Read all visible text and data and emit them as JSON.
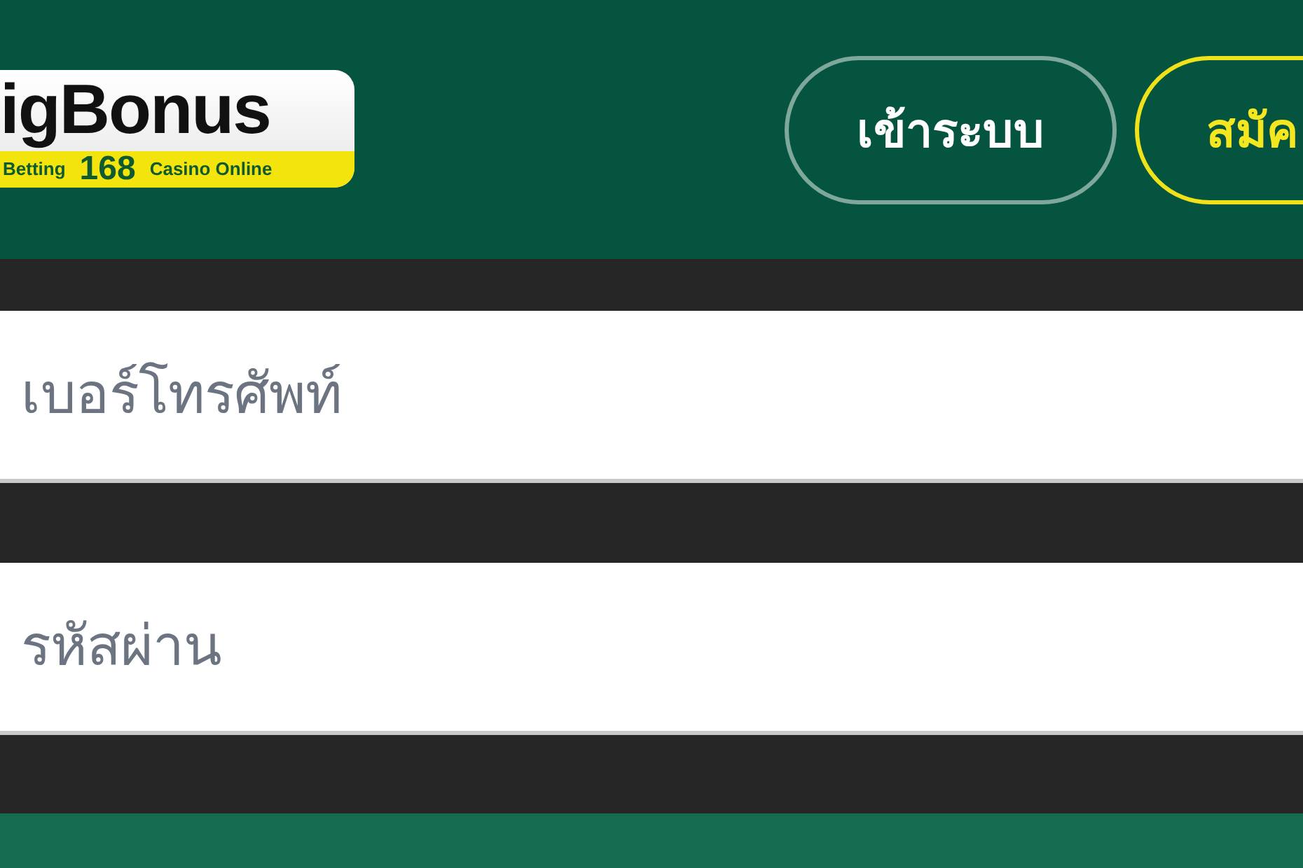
{
  "header": {
    "logo": {
      "name": "igBonus",
      "strip": [
        "Betting",
        "168",
        "Casino Online"
      ]
    },
    "buttons": [
      {
        "label": "เข้าระบบ",
        "kind": "outline"
      },
      {
        "label": "สมัค",
        "kind": "accent"
      }
    ]
  },
  "form": {
    "fields": [
      {
        "placeholder": "เบอร์โทรศัพท์"
      },
      {
        "placeholder": "รหัสผ่าน"
      }
    ]
  }
}
